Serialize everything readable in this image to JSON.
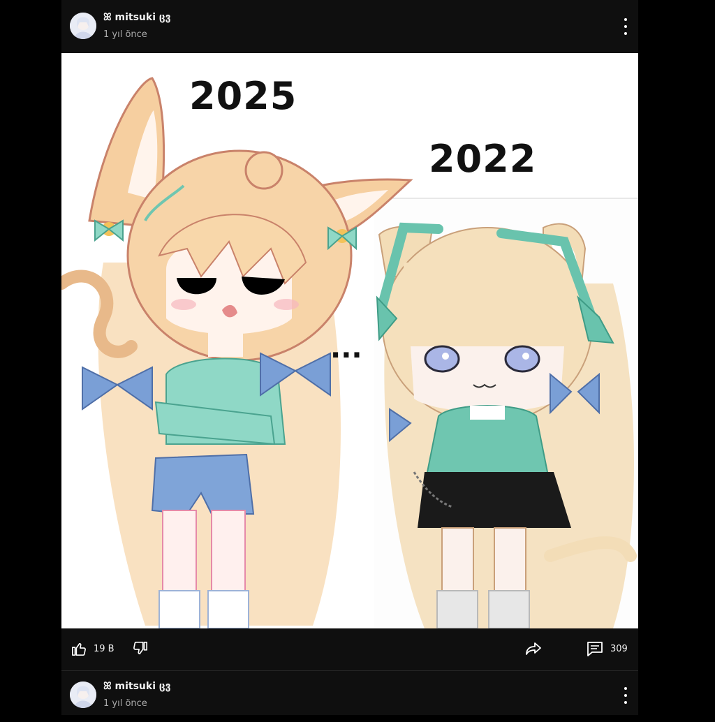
{
  "post": {
    "username": "ꕤ mitsuki ცვ",
    "time": "1 yıl önce"
  },
  "image_text": {
    "year_left": "2025",
    "year_right": "2022",
    "ellipsis": "..."
  },
  "actions": {
    "likes": "19 B",
    "comments": "309"
  },
  "next_post": {
    "username": "ꕤ mitsuki ცვ",
    "time": "1 yıl önce"
  },
  "icons": [
    "menu-dots-icon",
    "like-icon",
    "dislike-icon",
    "share-icon",
    "comment-icon"
  ],
  "colors": {
    "background": "#000000",
    "card": "#0f0f0f",
    "image_bg": "#ffffff",
    "hair": "#f6d6ad",
    "accent_teal": "#8fd8c6",
    "bow_blue": "#7a9fd6"
  }
}
